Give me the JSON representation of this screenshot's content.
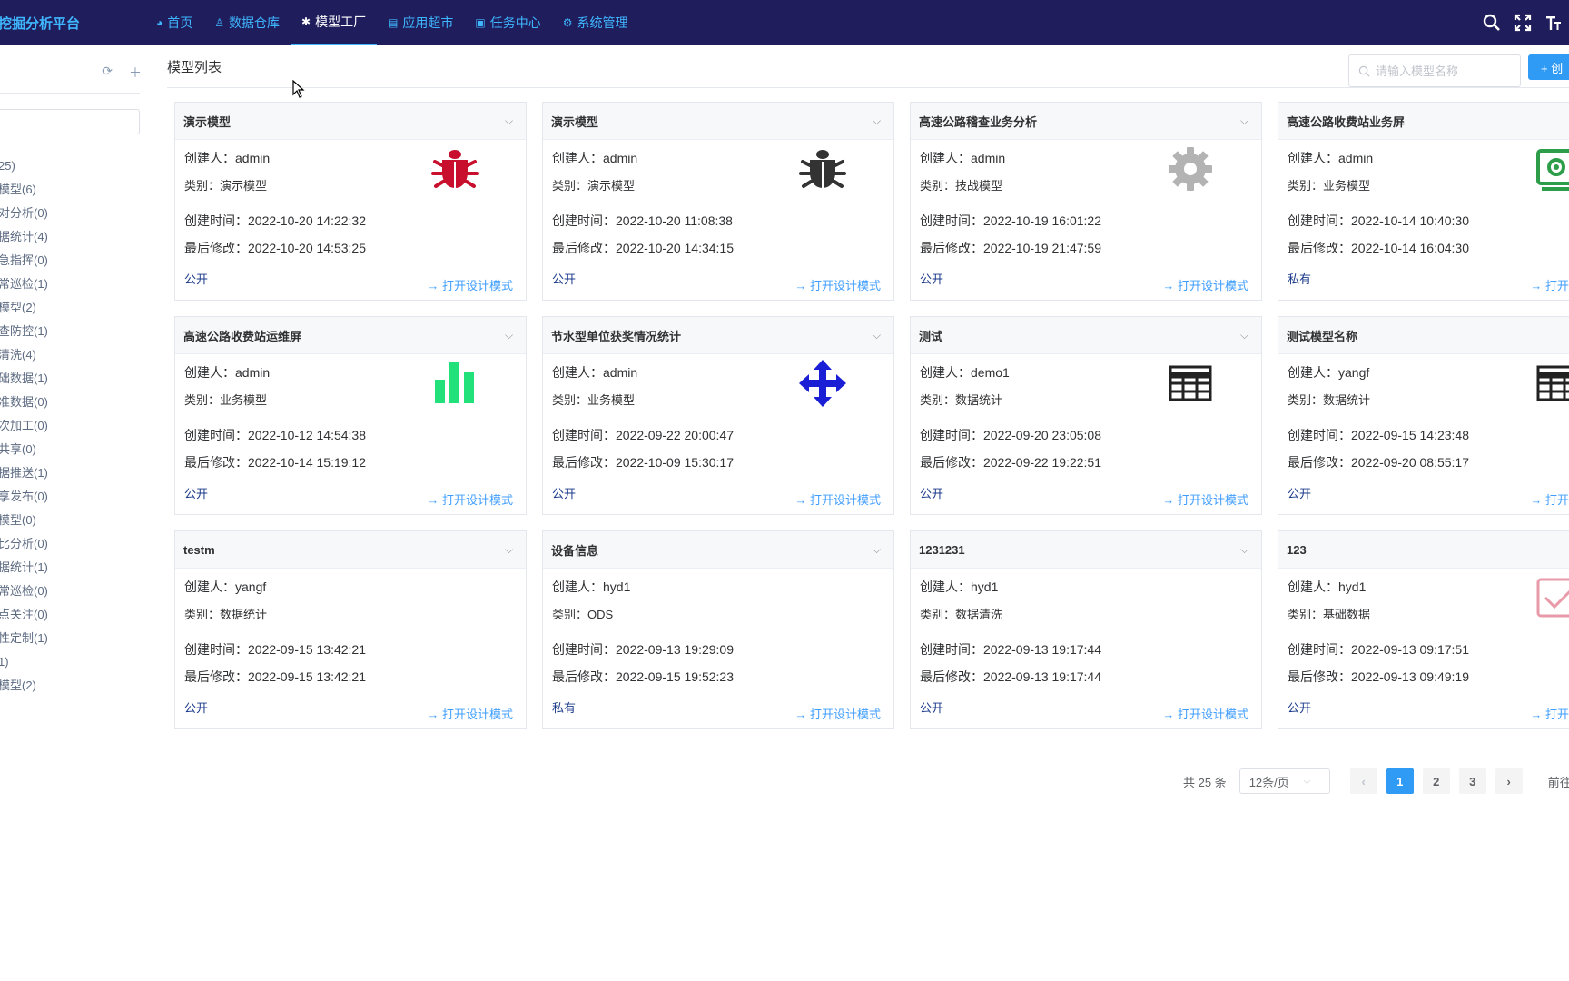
{
  "app": {
    "brand": "挖掘分析平台",
    "nav": [
      {
        "label": "首页",
        "icon": "dashboard-icon"
      },
      {
        "label": "数据仓库",
        "icon": "user-icon"
      },
      {
        "label": "模型工厂",
        "icon": "bug-icon",
        "active": true
      },
      {
        "label": "应用超市",
        "icon": "app-icon"
      },
      {
        "label": "任务中心",
        "icon": "monitor-icon"
      },
      {
        "label": "系统管理",
        "icon": "gear-icon"
      }
    ]
  },
  "sidebar": {
    "items": [
      "25)",
      "模型(6)",
      "对分析(0)",
      "据统计(4)",
      "急指挥(0)",
      "常巡检(1)",
      "模型(2)",
      "查防控(1)",
      "清洗(4)",
      "础数据(1)",
      "准数据(0)",
      "次加工(0)",
      "共享(0)",
      "据推送(1)",
      "享发布(0)",
      "模型(0)",
      "比分析(0)",
      "据统计(1)",
      "常巡检(0)",
      "点关注(0)",
      "性定制(1)",
      "1)",
      "模型(2)"
    ]
  },
  "main": {
    "title": "模型列表",
    "search_placeholder": "请输入模型名称",
    "create_label": "+ 创",
    "labels": {
      "creator": "创建人：",
      "category": "类别：",
      "created": "创建时间：",
      "modified": "最后修改：",
      "open": "打开设计模式"
    }
  },
  "cards": [
    {
      "title": "演示模型",
      "creator": "admin",
      "category": "演示模型",
      "created": "2022-10-20 14:22:32",
      "modified": "2022-10-20 14:53:25",
      "visibility": "公开",
      "icon": "bug-icon",
      "color": "#c8102e"
    },
    {
      "title": "演示模型",
      "creator": "admin",
      "category": "演示模型",
      "created": "2022-10-20 11:08:38",
      "modified": "2022-10-20 14:34:15",
      "visibility": "公开",
      "icon": "bug-icon",
      "color": "#333333"
    },
    {
      "title": "高速公路稽查业务分析",
      "creator": "admin",
      "category": "技战模型",
      "created": "2022-10-19 16:01:22",
      "modified": "2022-10-19 21:47:59",
      "visibility": "公开",
      "icon": "gear-icon",
      "color": "#b3b3b3"
    },
    {
      "title": "高速公路收费站业务屏",
      "creator": "admin",
      "category": "业务模型",
      "created": "2022-10-14 10:40:30",
      "modified": "2022-10-14 16:04:30",
      "visibility": "私有",
      "icon": "settings-panel-icon",
      "color": "#2e9d4a"
    },
    {
      "title": "高速公路收费站运维屏",
      "creator": "admin",
      "category": "业务模型",
      "created": "2022-10-12 14:54:38",
      "modified": "2022-10-14 15:19:12",
      "visibility": "公开",
      "icon": "bar-chart-icon",
      "color": "#22e07a"
    },
    {
      "title": "节水型单位获奖情况统计",
      "creator": "admin",
      "category": "业务模型",
      "created": "2022-09-22 20:00:47",
      "modified": "2022-10-09 15:30:17",
      "visibility": "公开",
      "icon": "move-icon",
      "color": "#1a1fd6"
    },
    {
      "title": "测试",
      "creator": "demo1",
      "category": "数据统计",
      "created": "2022-09-20 23:05:08",
      "modified": "2022-09-22 19:22:51",
      "visibility": "公开",
      "icon": "table-icon",
      "color": "#222222"
    },
    {
      "title": "测试模型名称",
      "creator": "yangf",
      "category": "数据统计",
      "created": "2022-09-15 14:23:48",
      "modified": "2022-09-20 08:55:17",
      "visibility": "公开",
      "icon": "table-icon",
      "color": "#222222"
    },
    {
      "title": "testm",
      "creator": "yangf",
      "category": "数据统计",
      "created": "2022-09-15 13:42:21",
      "modified": "2022-09-15 13:42:21",
      "visibility": "公开",
      "icon": "",
      "color": ""
    },
    {
      "title": "设备信息",
      "creator": "hyd1",
      "category": "ODS",
      "created": "2022-09-13 19:29:09",
      "modified": "2022-09-15 19:52:23",
      "visibility": "私有",
      "icon": "",
      "color": ""
    },
    {
      "title": "1231231",
      "creator": "hyd1",
      "category": "数据清洗",
      "created": "2022-09-13 19:17:44",
      "modified": "2022-09-13 19:17:44",
      "visibility": "公开",
      "icon": "",
      "color": ""
    },
    {
      "title": "123",
      "creator": "hyd1",
      "category": "基础数据",
      "created": "2022-09-13 09:17:51",
      "modified": "2022-09-13 09:49:19",
      "visibility": "公开",
      "icon": "checkbox-icon",
      "color": "#e89aa8"
    }
  ],
  "pagination": {
    "total": "共 25 条",
    "page_size": "12条/页",
    "pages": [
      "1",
      "2",
      "3"
    ],
    "current": "1",
    "goto": "前往"
  }
}
